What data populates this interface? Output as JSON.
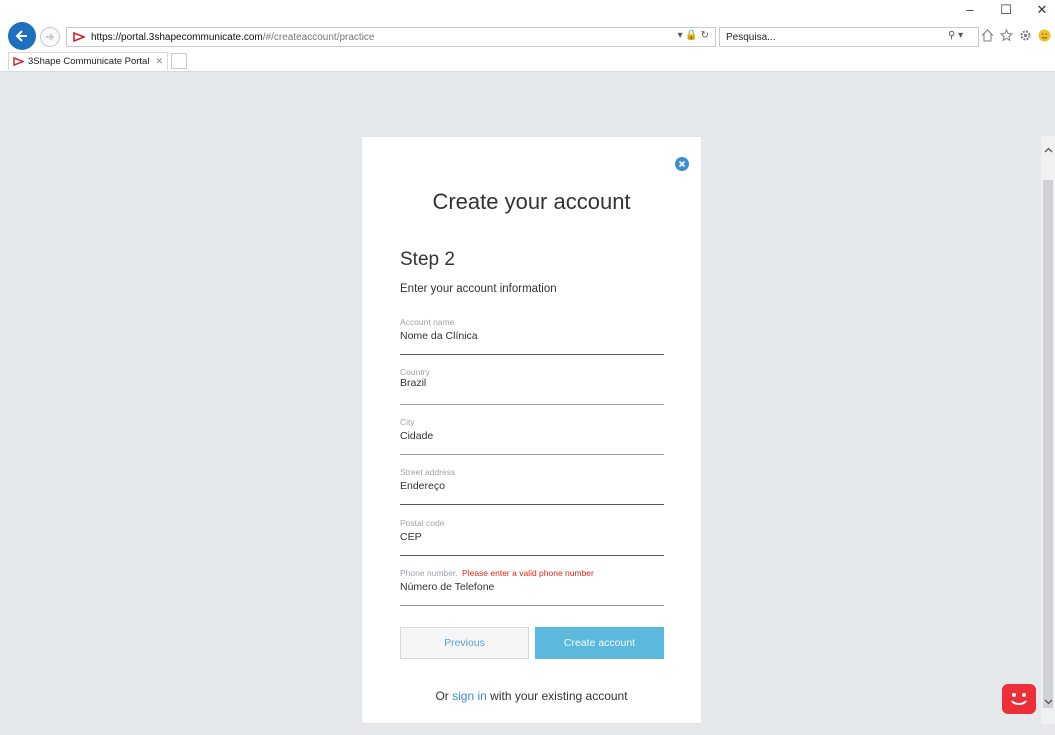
{
  "browser": {
    "window_controls": {
      "minimize": "–",
      "maximize": "☐",
      "close": "✕"
    },
    "address": {
      "base": "https://portal.3shapecommunicate.com",
      "rest": "/#/createaccount/practice",
      "right": "▾ 🔒 ↻"
    },
    "search": {
      "value": "Pesquisa...",
      "icon": "⚲ ▾"
    },
    "tab": {
      "title": "3Shape Communicate Portal",
      "close": "✕"
    },
    "icons": [
      "home-icon",
      "star-icon",
      "gear-icon",
      "smiley-icon"
    ]
  },
  "form": {
    "title": "Create your account",
    "step": "Step 2",
    "subtitle": "Enter your account information",
    "fields": [
      {
        "label": "Account name",
        "value": "Nome da Clínica"
      },
      {
        "label": "Country",
        "value": "Brazil"
      },
      {
        "label": "City",
        "value": "Cidade"
      },
      {
        "label": "Street address",
        "value": "Endereço"
      },
      {
        "label": "Postal code",
        "value": "CEP"
      },
      {
        "label": "Phone number.",
        "error": "Please enter a valid phone number",
        "value": "Número de Telefone"
      }
    ],
    "buttons": {
      "previous": "Previous",
      "create": "Create account"
    },
    "signin": {
      "prefix": "Or",
      "link": "sign in",
      "suffix": "with your existing account"
    }
  },
  "colors": {
    "accent": "#3b8fcf",
    "create_button": "#5db8de",
    "error": "#e0261b",
    "background": "#e6e9ec",
    "chat_bubble": "#ee2f3a"
  }
}
